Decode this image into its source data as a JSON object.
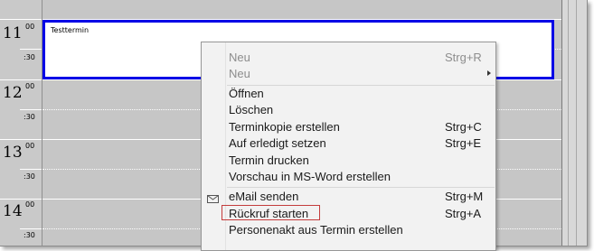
{
  "calendar": {
    "hours": [
      {
        "hour": "11",
        "min_00": "00",
        "min_30": ":30"
      },
      {
        "hour": "12",
        "min_00": "00",
        "min_30": ":30"
      },
      {
        "hour": "13",
        "min_00": "00",
        "min_30": ":30"
      },
      {
        "hour": "14",
        "min_00": "00",
        "min_30": ":30"
      }
    ],
    "appointment": {
      "title": "Testtermin",
      "border_color": "#0000e6"
    }
  },
  "context_menu": {
    "items": [
      {
        "label": "Neu",
        "shortcut": "Strg+R",
        "disabled": true
      },
      {
        "label": "Neu",
        "submenu": true,
        "disabled": true
      },
      {
        "label": "Öffnen"
      },
      {
        "label": "Löschen"
      },
      {
        "label": "Terminkopie erstellen",
        "shortcut": "Strg+C"
      },
      {
        "label": "Auf erledigt setzen",
        "shortcut": "Strg+E"
      },
      {
        "label": "Termin drucken"
      },
      {
        "label": "Vorschau in MS-Word erstellen"
      },
      {
        "label": "eMail senden",
        "shortcut": "Strg+M",
        "icon": "envelope-icon"
      },
      {
        "label": "Rückruf starten",
        "shortcut": "Strg+A",
        "highlight_color": "#c43c3c"
      },
      {
        "label": "Personenakt aus Termin erstellen"
      }
    ]
  }
}
